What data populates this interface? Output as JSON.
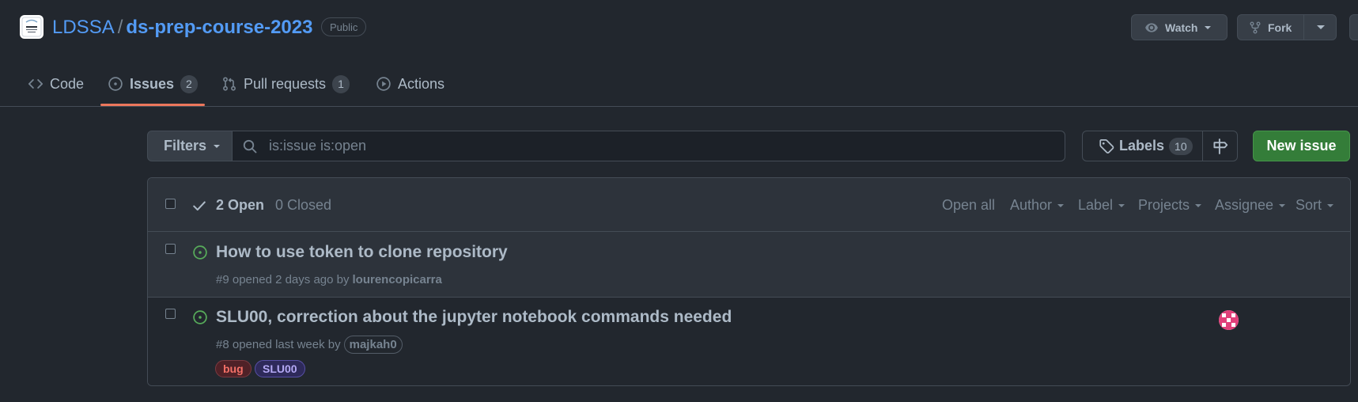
{
  "repo": {
    "owner": "LDSSA",
    "separator": "/",
    "name": "ds-prep-course-2023",
    "visibility": "Public"
  },
  "header_actions": {
    "watch_label": "Watch",
    "fork_label": "Fork"
  },
  "tabs": [
    {
      "label": "Code",
      "icon": "code-icon"
    },
    {
      "label": "Issues",
      "count": "2",
      "icon": "issue-opened-icon",
      "selected": true
    },
    {
      "label": "Pull requests",
      "count": "1",
      "icon": "git-pull-request-icon"
    },
    {
      "label": "Actions",
      "icon": "play-icon"
    }
  ],
  "filter_bar": {
    "filters_label": "Filters",
    "search_placeholder": "is:issue is:open",
    "labels_label": "Labels",
    "labels_count": "10",
    "new_issue_label": "New issue"
  },
  "issues_header": {
    "open_label": "2 Open",
    "closed_label": "0 Closed",
    "filters": [
      "Open all",
      "Author",
      "Label",
      "Projects",
      "Assignee",
      "Sort"
    ]
  },
  "issues": [
    {
      "title": "How to use token to clone repository",
      "number": "#9",
      "opened_text": "opened 2 days ago by",
      "author": "lourencopicarra",
      "labels": []
    },
    {
      "title": "SLU00, correction about the jupyter notebook commands needed",
      "number": "#8",
      "opened_text": "opened last week by",
      "author": "majkah0",
      "labels": [
        {
          "name": "bug",
          "color": "#f47067"
        },
        {
          "name": "SLU00",
          "color": "#b4a9f5"
        }
      ]
    }
  ],
  "colors": {
    "background": "#22272e",
    "link": "#539bf5",
    "open_issue": "#57ab5a",
    "new_issue_button": "#347d39",
    "tab_underline": "#ec775c"
  }
}
